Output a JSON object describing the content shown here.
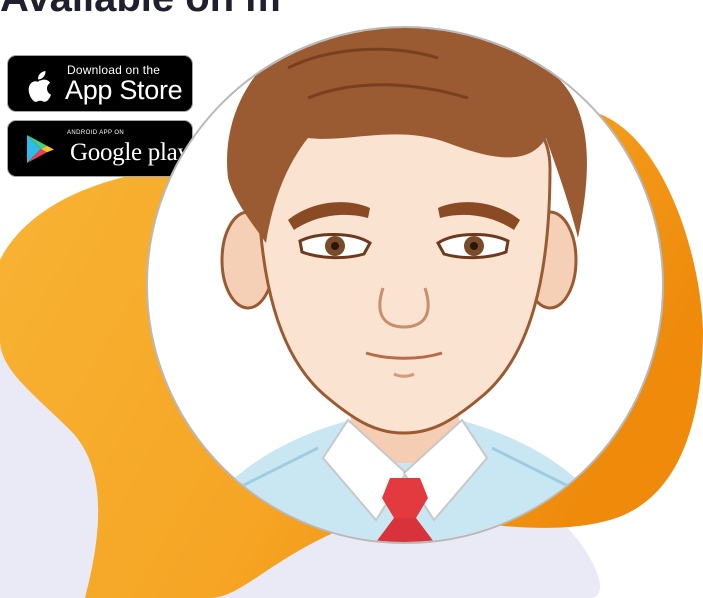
{
  "heading": {
    "text": "Available on mobile now!"
  },
  "badges": {
    "app_store": {
      "small_text": "Download on the",
      "big_text": "App Store",
      "icon": "apple-icon"
    },
    "google_play": {
      "small_text": "ANDROID APP ON",
      "big_text": "Google play",
      "icon": "google-play-icon"
    }
  },
  "avatar": {
    "icon": "cartoon-man-avatar"
  },
  "colors": {
    "orange_light": "#f8b436",
    "orange_dark": "#f08a0c",
    "lavender": "#e9eaf6",
    "skin": "#fbe3d1",
    "hair": "#9a5a32",
    "shirt": "#c9e6f3",
    "tie": "#e23a3f"
  }
}
